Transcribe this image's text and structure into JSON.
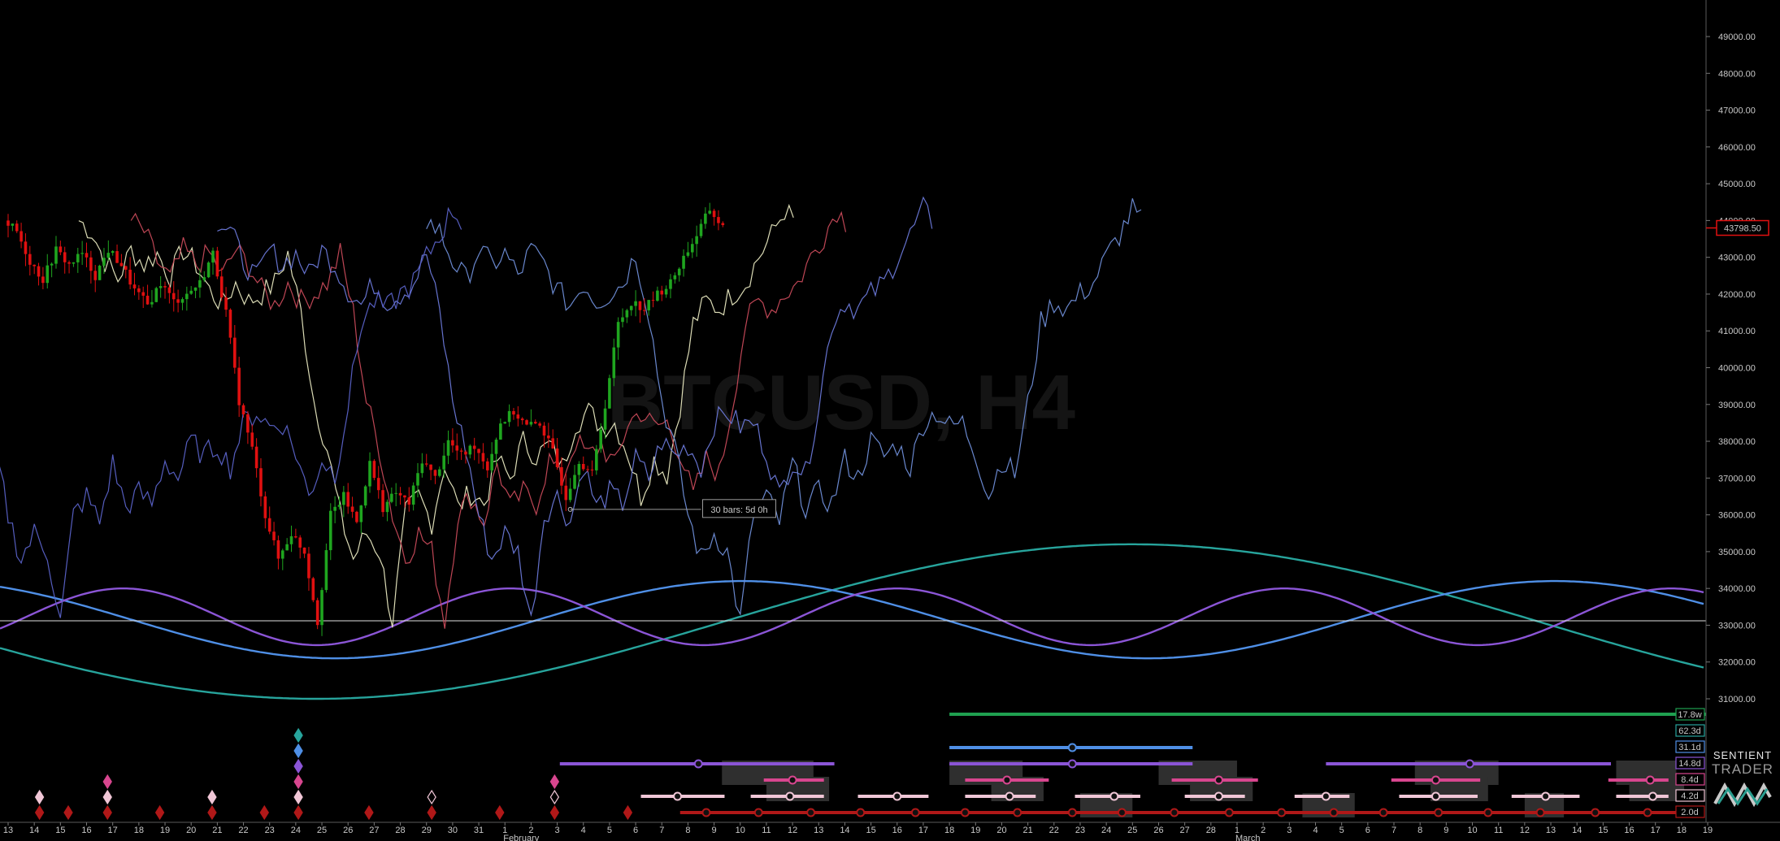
{
  "watermark": "BTCUSD, H4",
  "brand": {
    "line1": "SENTIENT",
    "line2": "TRADER"
  },
  "colors": {
    "background": "#000000",
    "up_candle": "#1fa51f",
    "down_candle": "#e01010",
    "cycle_17_8w": "#1fa050",
    "cycle_62_3d": "#27a49c",
    "cycle_31_1d": "#4f8fe6",
    "cycle_14_8d": "#8b55d6",
    "cycle_8_4d": "#d8468f",
    "cycle_4_2d": "#f0c6d6",
    "cycle_2_0d": "#b01818"
  },
  "chart_data": {
    "type": "line",
    "title": "BTCUSD, H4",
    "y_axis": {
      "ylim": [
        30600,
        49700
      ],
      "ticks": [
        "49000.00",
        "48000.00",
        "47000.00",
        "46000.00",
        "45000.00",
        "44000.00",
        "43000.00",
        "42000.00",
        "41000.00",
        "40000.00",
        "39000.00",
        "38000.00",
        "37000.00",
        "36000.00",
        "35000.00",
        "34000.00",
        "33000.00",
        "32000.00",
        "31000.00"
      ],
      "tick_values": [
        49000,
        48000,
        47000,
        46000,
        45000,
        44000,
        43000,
        42000,
        41000,
        40000,
        39000,
        38000,
        37000,
        36000,
        35000,
        34000,
        33000,
        32000,
        31000
      ]
    },
    "x_axis": {
      "day_labels": [
        "13",
        "14",
        "15",
        "16",
        "17",
        "18",
        "19",
        "20",
        "21",
        "22",
        "23",
        "24",
        "25",
        "26",
        "27",
        "28",
        "29",
        "30",
        "31",
        "1",
        "2",
        "3",
        "4",
        "5",
        "6",
        "7",
        "8",
        "9",
        "10",
        "11",
        "12",
        "13",
        "14",
        "15",
        "16",
        "17",
        "18",
        "19",
        "20",
        "21",
        "22",
        "23",
        "24",
        "25",
        "26",
        "27",
        "28",
        "1",
        "2",
        "3",
        "4",
        "5",
        "6",
        "7",
        "8",
        "9",
        "10",
        "11",
        "12",
        "13",
        "14",
        "15",
        "16",
        "17",
        "18",
        "19"
      ],
      "month_labels": [
        {
          "label": "February",
          "day_index": 19
        },
        {
          "label": "March",
          "day_index": 47
        }
      ]
    },
    "last_price": "43798.50",
    "horizontal_level": 33120,
    "measurement": {
      "label": "30 bars: 5d 0h",
      "start_day": 21.5,
      "end_day": 26.5,
      "price": 36150
    },
    "price_series": {
      "name": "",
      "points": [
        [
          0,
          44000
        ],
        [
          0.5,
          43700
        ],
        [
          1,
          42900
        ],
        [
          1.5,
          42400
        ],
        [
          2,
          43200
        ],
        [
          2.5,
          42800
        ],
        [
          3,
          43100
        ],
        [
          3.5,
          42500
        ],
        [
          4,
          43200
        ],
        [
          4.5,
          42800
        ],
        [
          5,
          42100
        ],
        [
          5.5,
          41700
        ],
        [
          6,
          42300
        ],
        [
          6.5,
          41800
        ],
        [
          7,
          42000
        ],
        [
          7.5,
          42300
        ],
        [
          8,
          43100
        ],
        [
          8.5,
          41500
        ],
        [
          9,
          39100
        ],
        [
          9.5,
          37800
        ],
        [
          10,
          36000
        ],
        [
          10.5,
          34800
        ],
        [
          11,
          35500
        ],
        [
          11.5,
          35000
        ],
        [
          12,
          33100
        ],
        [
          12.5,
          36000
        ],
        [
          13,
          36500
        ],
        [
          13.5,
          35800
        ],
        [
          14,
          37400
        ],
        [
          14.5,
          36200
        ],
        [
          15,
          36600
        ],
        [
          15.5,
          36300
        ],
        [
          16,
          37500
        ],
        [
          16.5,
          37000
        ],
        [
          17,
          38000
        ],
        [
          17.5,
          37600
        ],
        [
          18,
          37900
        ],
        [
          18.5,
          37300
        ],
        [
          19,
          38500
        ],
        [
          19.5,
          38800
        ],
        [
          20,
          38400
        ],
        [
          20.5,
          38500
        ],
        [
          21,
          37700
        ],
        [
          21.5,
          36500
        ],
        [
          22,
          37500
        ],
        [
          22.5,
          37100
        ],
        [
          23,
          39000
        ],
        [
          23.5,
          41200
        ],
        [
          24,
          41800
        ],
        [
          24.5,
          41600
        ],
        [
          25,
          42000
        ],
        [
          25.5,
          42300
        ],
        [
          26,
          43000
        ],
        [
          26.5,
          43600
        ],
        [
          27,
          44300
        ],
        [
          27.5,
          43800
        ]
      ]
    },
    "projection_series": [
      {
        "name": "",
        "color": "#e8e8c0",
        "offset_days": 2.7
      },
      {
        "name": "",
        "color": "#c84a5a",
        "offset_days": 4.7
      },
      {
        "name": "",
        "color": "#6a78d8",
        "offset_days": 8.0
      },
      {
        "name": "",
        "color": "#6f8ed8",
        "offset_days": 16.0
      },
      {
        "name": "",
        "color": "#5a62c8",
        "offset_days": -10.0
      }
    ],
    "cycle_waves": [
      {
        "name": "",
        "color": "#27a49c",
        "period_days": 62.3,
        "trough_day": 11.8,
        "amplitude": 2100,
        "mid": 33100
      },
      {
        "name": "",
        "color": "#4f8fe6",
        "period_days": 31.1,
        "trough_day": 12.5,
        "amplitude": 1050,
        "mid": 33150
      },
      {
        "name": "",
        "color": "#8b55d6",
        "period_days": 14.8,
        "trough_day": 11.8,
        "amplitude": 770,
        "mid": 33230
      }
    ],
    "cycle_labels": [
      {
        "label": "17.8w",
        "color": "#1fa050"
      },
      {
        "label": "62.3d",
        "color": "#27a49c"
      },
      {
        "label": "31.1d",
        "color": "#4f8fe6"
      },
      {
        "label": "14.8d",
        "color": "#8b55d6"
      },
      {
        "label": "8.4d",
        "color": "#d8468f"
      },
      {
        "label": "4.2d",
        "color": "#f0c6d6"
      },
      {
        "label": "2.0d",
        "color": "#b01818"
      }
    ],
    "phasing_bars": [
      {
        "color": "#1fa050",
        "segments": [
          [
            36.0,
            66.5
          ]
        ],
        "markers": []
      },
      {
        "color": "#4f8fe6",
        "segments": [
          [
            36.0,
            45.3
          ]
        ],
        "markers": [
          40.7
        ]
      },
      {
        "color": "#8b55d6",
        "segments": [
          [
            21.1,
            31.6
          ],
          [
            36.0,
            45.3
          ],
          [
            50.4,
            61.3
          ]
        ],
        "markers": [
          26.4,
          40.7,
          55.9
        ]
      },
      {
        "color": "#d8468f",
        "segments": [
          [
            28.9,
            31.2
          ],
          [
            36.6,
            39.8
          ],
          [
            44.5,
            47.8
          ],
          [
            52.9,
            56.3
          ],
          [
            61.2,
            63.5
          ]
        ],
        "markers": [
          30.0,
          38.2,
          46.3,
          54.6,
          62.8
        ]
      },
      {
        "color": "#f0c6d6",
        "segments": [
          [
            24.2,
            27.4
          ],
          [
            28.4,
            31.2
          ],
          [
            32.5,
            35.2
          ],
          [
            36.6,
            39.3
          ],
          [
            40.8,
            43.3
          ],
          [
            45.0,
            47.3
          ],
          [
            49.2,
            51.3
          ],
          [
            53.2,
            56.2
          ],
          [
            57.5,
            60.1
          ],
          [
            61.5,
            63.5
          ]
        ],
        "markers": [
          25.6,
          29.9,
          34.0,
          38.3,
          42.3,
          46.3,
          50.4,
          54.6,
          58.8,
          62.9
        ]
      },
      {
        "color": "#b01818",
        "segments": [
          [
            25.7,
            63.8
          ]
        ],
        "markers": [
          26.7,
          28.7,
          30.7,
          32.6,
          34.7,
          36.6,
          38.6,
          40.7,
          42.6,
          44.6,
          46.7,
          48.7,
          50.7,
          52.6,
          54.7,
          56.6,
          58.6,
          60.7,
          62.7
        ]
      }
    ],
    "phasing_boxes": [
      [
        27.3,
        30.8,
        0,
        1
      ],
      [
        29.0,
        31.4,
        1,
        2
      ],
      [
        36.0,
        38.8,
        0,
        1
      ],
      [
        37.6,
        39.6,
        1,
        2
      ],
      [
        44.0,
        47.0,
        0,
        1
      ],
      [
        45.2,
        47.6,
        1,
        2
      ],
      [
        53.8,
        57.0,
        0,
        1
      ],
      [
        54.4,
        56.6,
        1,
        2
      ],
      [
        61.5,
        63.8,
        0,
        1
      ],
      [
        62.0,
        64.1,
        1,
        2
      ],
      [
        41.0,
        43.0,
        2,
        3
      ],
      [
        49.5,
        51.5,
        2,
        3
      ],
      [
        58.0,
        59.5,
        2,
        3
      ]
    ],
    "diamonds": [
      {
        "day": 1.2,
        "colors": [
          "#b01818",
          "#f0c6d6"
        ]
      },
      {
        "day": 2.3,
        "colors": [
          "#b01818"
        ]
      },
      {
        "day": 3.8,
        "colors": [
          "#b01818",
          "#f0c6d6",
          "#d8468f"
        ]
      },
      {
        "day": 5.8,
        "colors": [
          "#b01818"
        ]
      },
      {
        "day": 7.8,
        "colors": [
          "#b01818",
          "#f0c6d6"
        ]
      },
      {
        "day": 9.8,
        "colors": [
          "#b01818"
        ]
      },
      {
        "day": 11.1,
        "colors": [
          "#b01818",
          "#f0c6d6",
          "#d8468f",
          "#8b55d6",
          "#4f8fe6",
          "#27a49c"
        ]
      },
      {
        "day": 13.8,
        "colors": [
          "#b01818"
        ]
      },
      {
        "day": 16.2,
        "colors": [
          "#b01818",
          "#f0c6d6"
        ]
      },
      {
        "day": 18.8,
        "colors": [
          "#b01818"
        ]
      },
      {
        "day": 20.9,
        "colors": [
          "#b01818",
          "#f0c6d6",
          "#d8468f"
        ]
      },
      {
        "day": 23.7,
        "colors": [
          "#b01818"
        ]
      }
    ]
  }
}
